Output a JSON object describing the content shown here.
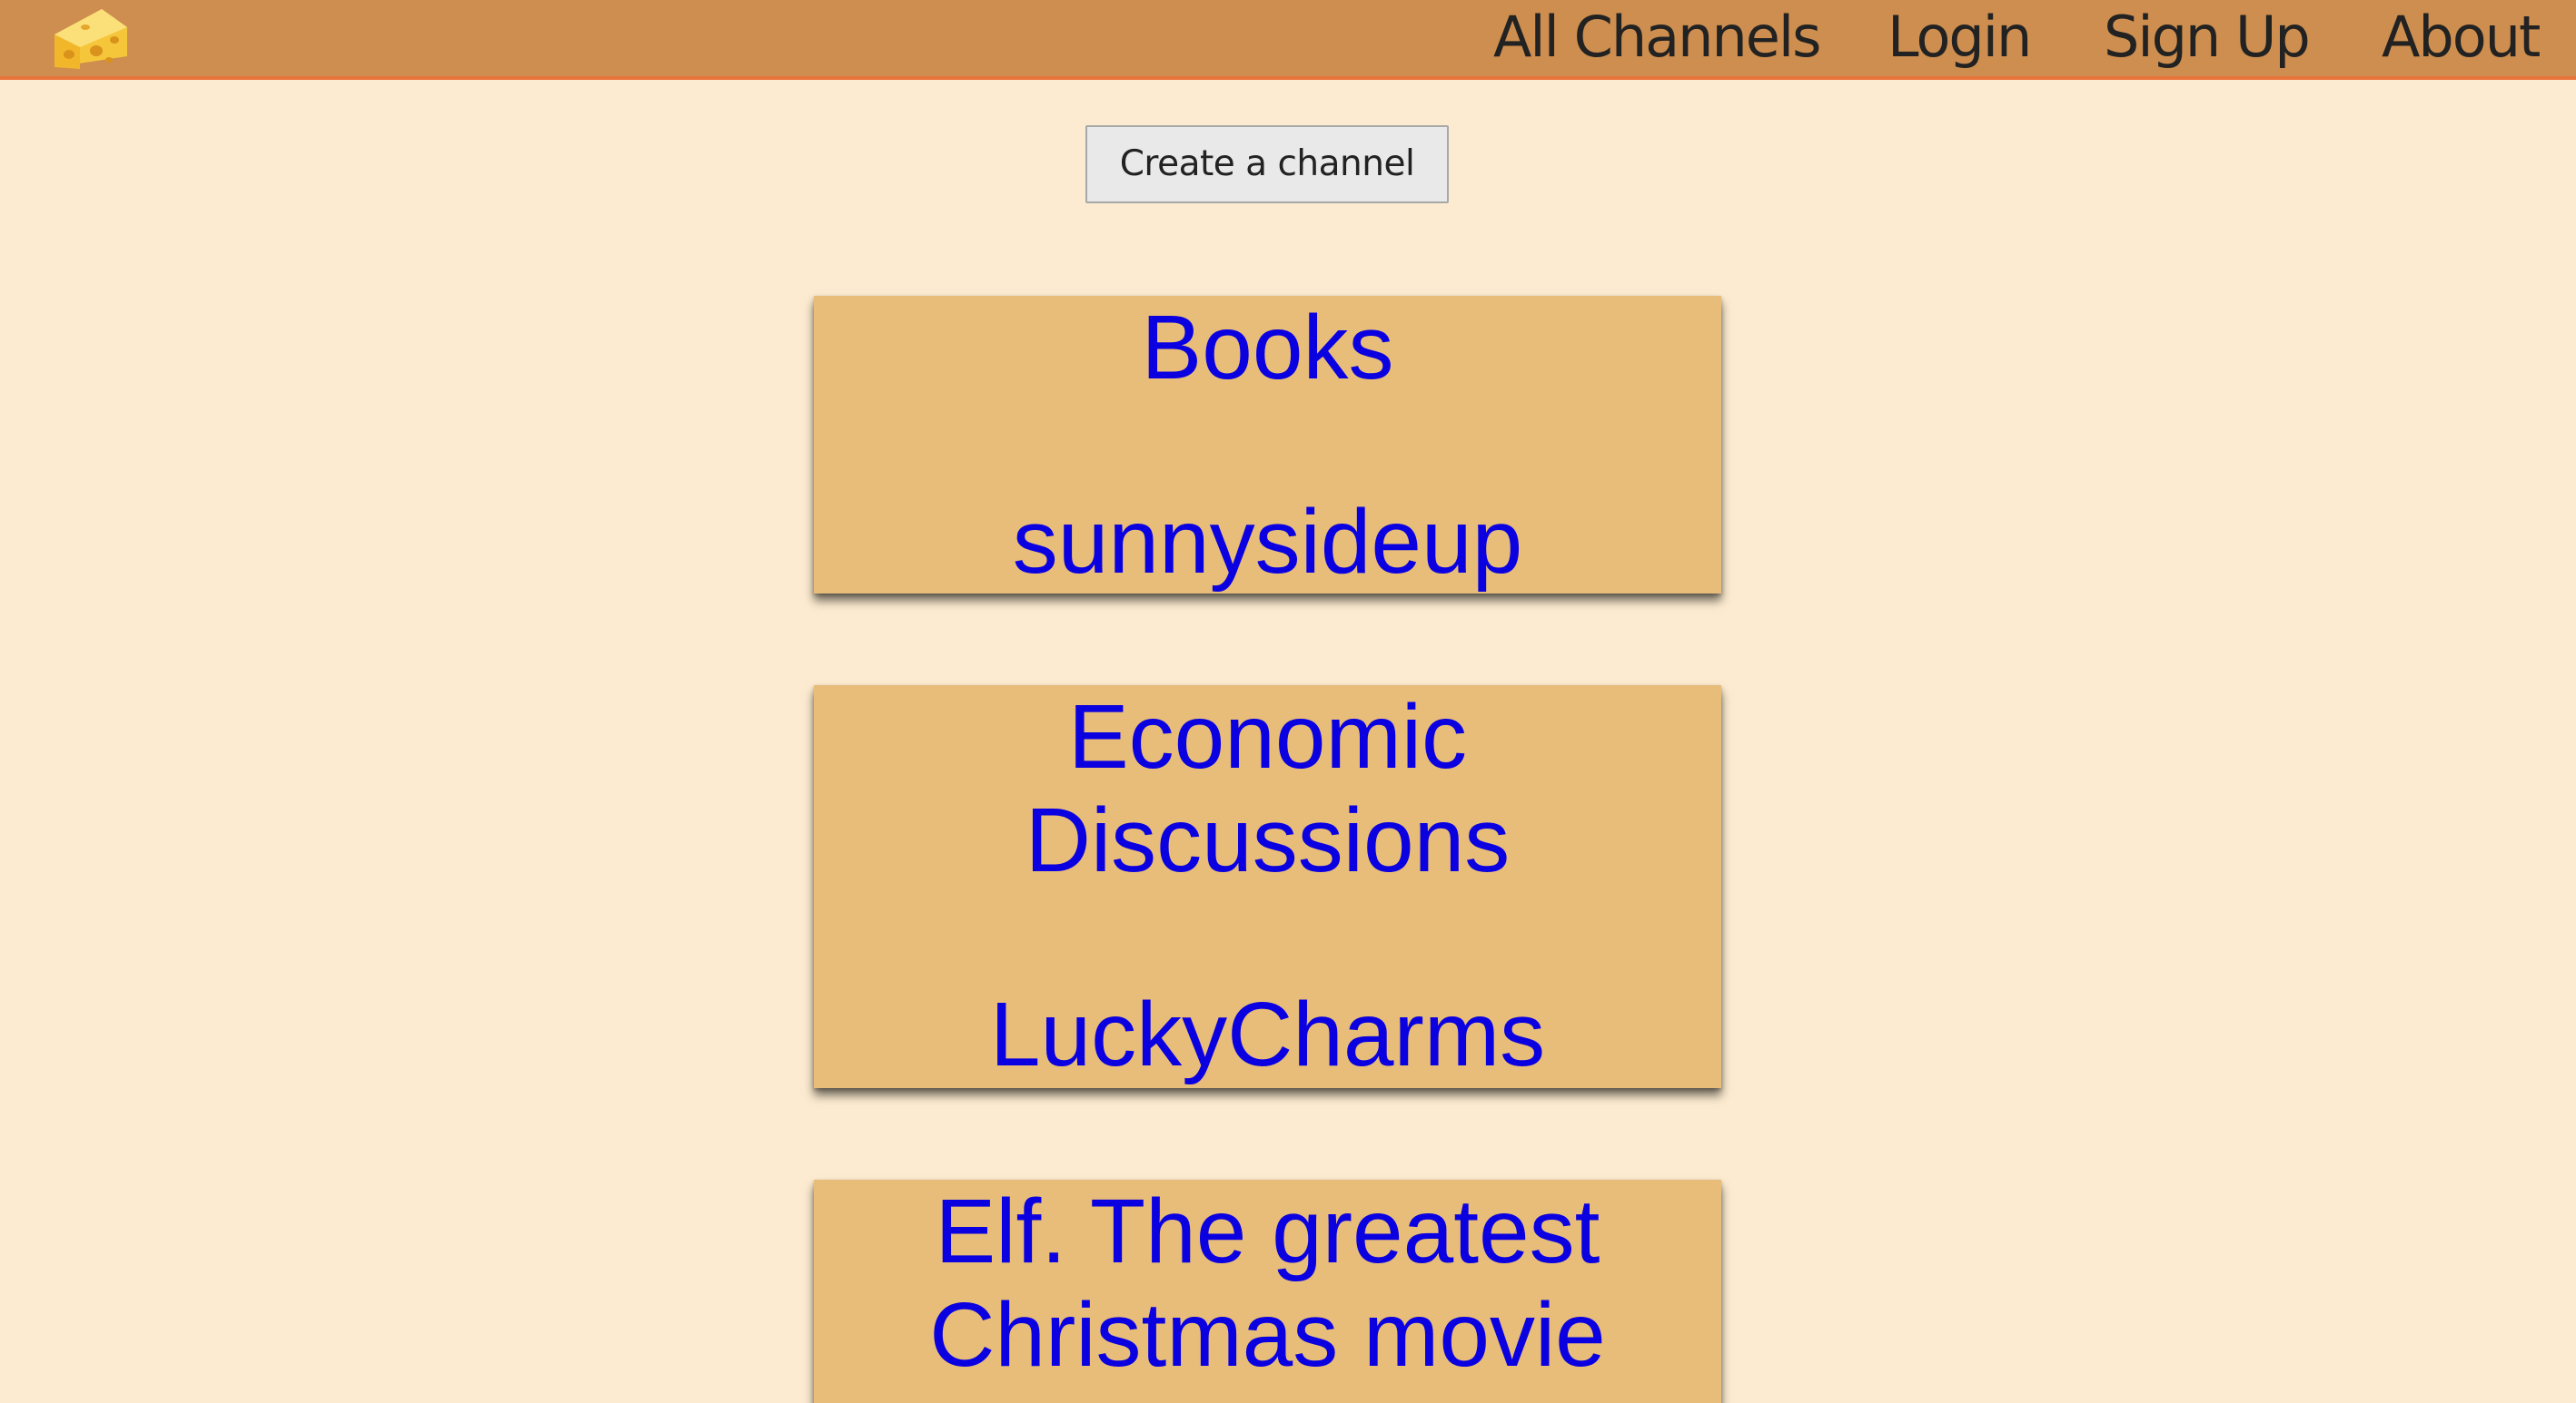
{
  "colors": {
    "page_background": "#fcebd0",
    "navbar_background": "#cd8e4f",
    "navbar_border": "#e8743b",
    "card_background": "#e7bd79",
    "card_text": "#0a00e0"
  },
  "navbar": {
    "logo_icon": "cheese-icon",
    "links": [
      {
        "label": "All Channels"
      },
      {
        "label": "Login"
      },
      {
        "label": "Sign Up"
      },
      {
        "label": "About"
      }
    ]
  },
  "actions": {
    "create_channel_label": "Create a channel"
  },
  "channels": [
    {
      "title": "Books",
      "author": "sunnysideup"
    },
    {
      "title": "Economic Discussions",
      "author": "LuckyCharms"
    },
    {
      "title": "Elf. The greatest Christmas movie",
      "author": ""
    }
  ]
}
